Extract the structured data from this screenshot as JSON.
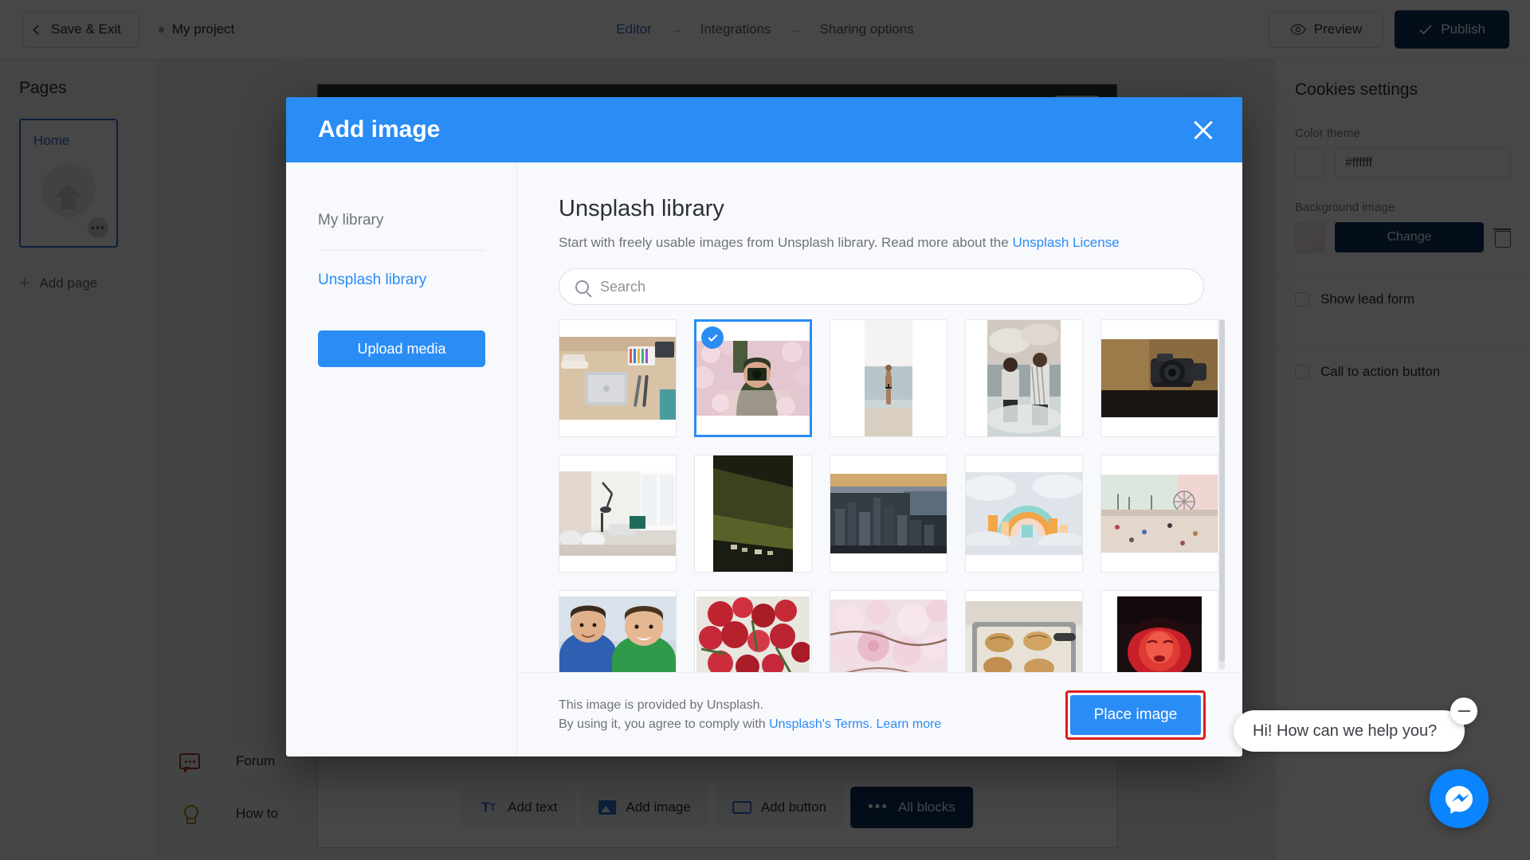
{
  "topbar": {
    "save_exit": "Save & Exit",
    "project_name": "My project",
    "steps": [
      {
        "label": "Editor",
        "active": true
      },
      {
        "label": "Integrations",
        "active": false
      },
      {
        "label": "Sharing options",
        "active": false
      }
    ],
    "arrow": "→",
    "preview": "Preview",
    "publish": "Publish"
  },
  "pages": {
    "title": "Pages",
    "page_label": "Home",
    "page_menu": "•••",
    "add_page": "Add page"
  },
  "settings": {
    "title": "Cookies settings",
    "color_theme_label": "Color theme",
    "color_value": "#ffffff",
    "background_label": "Background image",
    "change": "Change",
    "show_lead_form": "Show lead form",
    "call_to_action": "Call to action button"
  },
  "blocks_toolbar": [
    {
      "label": "Add text",
      "icon": "text-icon"
    },
    {
      "label": "Add image",
      "icon": "image-icon"
    },
    {
      "label": "Add button",
      "icon": "button-icon"
    },
    {
      "label": "All blocks",
      "icon": "ellipsis-icon"
    }
  ],
  "helpers": [
    {
      "label": "Forum",
      "icon": "chat-bubble-icon"
    },
    {
      "label": "How to",
      "icon": "lightbulb-icon"
    }
  ],
  "modal": {
    "title": "Add image",
    "sidebar": {
      "my_library": "My library",
      "unsplash_library": "Unsplash library",
      "upload_media": "Upload media"
    },
    "main": {
      "heading": "Unsplash library",
      "subtitle_prefix": "Start with freely usable images from Unsplash library. Read more about the ",
      "license_link": "Unsplash License",
      "search_placeholder": "Search",
      "search_value": ""
    },
    "footer": {
      "line1": "This image is provided by Unsplash.",
      "line2_prefix": "By using it, you agree to comply with ",
      "terms_link": "Unsplash's Terms.",
      "learn_more_link": "Learn more",
      "place_image": "Place image"
    },
    "grid": [
      {
        "name": "laptop-desk-flatlay",
        "selected": false
      },
      {
        "name": "woman-with-camera-blossoms",
        "selected": true
      },
      {
        "name": "woman-standing-on-beach",
        "selected": false
      },
      {
        "name": "two-women-in-surf",
        "selected": false
      },
      {
        "name": "camera-on-wooden-table",
        "selected": false
      },
      {
        "name": "bright-modern-lounge",
        "selected": false
      },
      {
        "name": "dark-mountain-hillside",
        "selected": false
      },
      {
        "name": "aerial-city-skyline",
        "selected": false
      },
      {
        "name": "pastel-3d-rainbow-render",
        "selected": false
      },
      {
        "name": "beach-ferris-wheel-pier",
        "selected": false
      },
      {
        "name": "two-young-men-portrait",
        "selected": false
      },
      {
        "name": "red-bougainvillea-flowers",
        "selected": false
      },
      {
        "name": "pink-cherry-blossoms",
        "selected": false
      },
      {
        "name": "baked-pastries-on-tray",
        "selected": false
      },
      {
        "name": "woman-in-red-light",
        "selected": false
      }
    ]
  },
  "chat": {
    "message": "Hi! How can we help you?",
    "minimize": "minimize-icon",
    "fab": "messenger-icon"
  },
  "colors": {
    "accent_blue": "#2a8cf5",
    "navy": "#0f2f5e",
    "highlight_red": "#e01b1b"
  }
}
